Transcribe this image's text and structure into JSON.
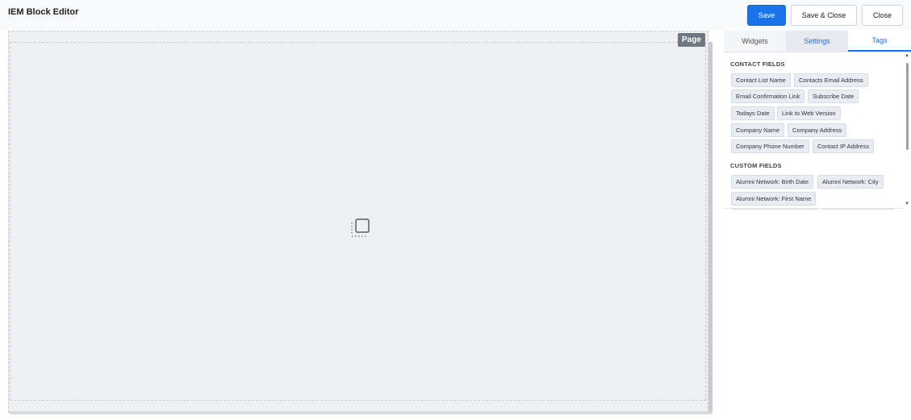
{
  "app": {
    "title": "IEM Block Editor"
  },
  "toolbar": {
    "save_label": "Save",
    "save_close_label": "Save & Close",
    "close_label": "Close"
  },
  "canvas": {
    "badge": "Page",
    "placeholder_icon": "block-placeholder-icon"
  },
  "panel": {
    "tabs": [
      {
        "label": "Widgets"
      },
      {
        "label": "Settings"
      },
      {
        "label": "Tags"
      }
    ],
    "contact_fields_title": "CONTACT FIELDS",
    "contact_fields": [
      "Contact List Name",
      "Contacts Email Address",
      "Email Confirmation Link",
      "Subscribe Date",
      "Todays Date",
      "Link to Web Version",
      "Company Name",
      "Company Address",
      "Company Phone Number",
      "Contact IP Address"
    ],
    "custom_fields_title": "CUSTOM FIELDS",
    "custom_fields": [
      "Alumni Network: Birth Date",
      "Alumni Network: City",
      "Alumni Network: First Name"
    ]
  },
  "colors": {
    "accent": "#1a73e8",
    "badge": "#6f7780",
    "canvas": "#eef0f2"
  }
}
